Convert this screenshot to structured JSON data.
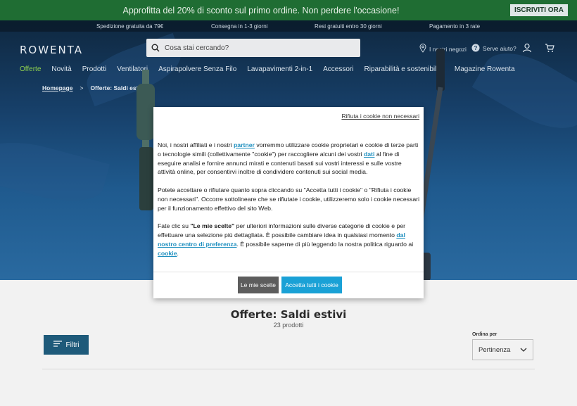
{
  "promo": {
    "text": "Approfitta del 20% di sconto sul primo ordine. Non perdere l'occasione!",
    "button": "ISCRIVITI ORA"
  },
  "benefits": [
    "Spedizione gratuita da 79€",
    "Consegna in 1-3 giorni",
    "Resi gratuiti entro 30 giorni",
    "Pagamento in 3 rate"
  ],
  "header": {
    "logo": "ROWENTA",
    "search_placeholder": "Cosa stai cercando?",
    "stores": "I nostri negozi",
    "help": "Serve aiuto?"
  },
  "nav": [
    "Offerte",
    "Novità",
    "Prodotti",
    "Ventilatori",
    "Aspirapolvere Senza Filo",
    "Lavapavimenti 2-in-1",
    "Accessori",
    "Riparabilità e sostenibilità",
    "Magazine Rowenta"
  ],
  "breadcrumb": {
    "home": "Homepage",
    "separator": ">",
    "current": "Offerte: Saldi estivi"
  },
  "listing": {
    "title": "Offerte: Saldi estivi",
    "count": "23 prodotti",
    "filter_button": "Filtri",
    "sort_label": "Ordina per",
    "sort_value": "Pertinenza"
  },
  "cookie": {
    "reject_link": "Rifiuta i cookie non necessari",
    "p1_a": "Noi, i nostri affiliati e i nostri ",
    "p1_link1": "partner",
    "p1_b": " vorremmo utilizzare cookie proprietari e cookie di terze parti o tecnologie simili (collettivamente \"cookie\") per raccogliere alcuni dei vostri ",
    "p1_link2": "dati",
    "p1_c": " al fine di eseguire analisi e fornire annunci mirati e contenuti basati sui vostri interessi e sulle vostre attività online, per consentirvi inoltre di condividere contenuti sui social media.",
    "p2": "Potete accettare o rifiutare quanto sopra cliccando su \"Accetta tutti i cookie\" o \"Rifiuta i cookie non necessari\". Occorre sottolineare che se rifiutate i cookie, utilizzeremo solo i cookie necessari per il funzionamento effettivo del sito Web.",
    "p3_a": "Fate clic su ",
    "p3_bold": "\"Le mie scelte\"",
    "p3_b": " per ulteriori informazioni sulle diverse categorie di cookie e per effettuare una selezione più dettagliata. È possibile cambiare idea in qualsiasi momento ",
    "p3_link1": "dal nostro centro di preferenza",
    "p3_c": ". È possibile saperne di più leggendo la nostra politica riguardo ai ",
    "p3_link2": "cookie",
    "p3_d": ".",
    "btn_choices": "Le mie scelte",
    "btn_accept": "Accetta tutti i cookie"
  },
  "colors": {
    "promo_bg": "#1f6d33",
    "nav_active": "#8fd04e",
    "accept": "#1aa1d6",
    "filter": "#1e5a7a"
  }
}
